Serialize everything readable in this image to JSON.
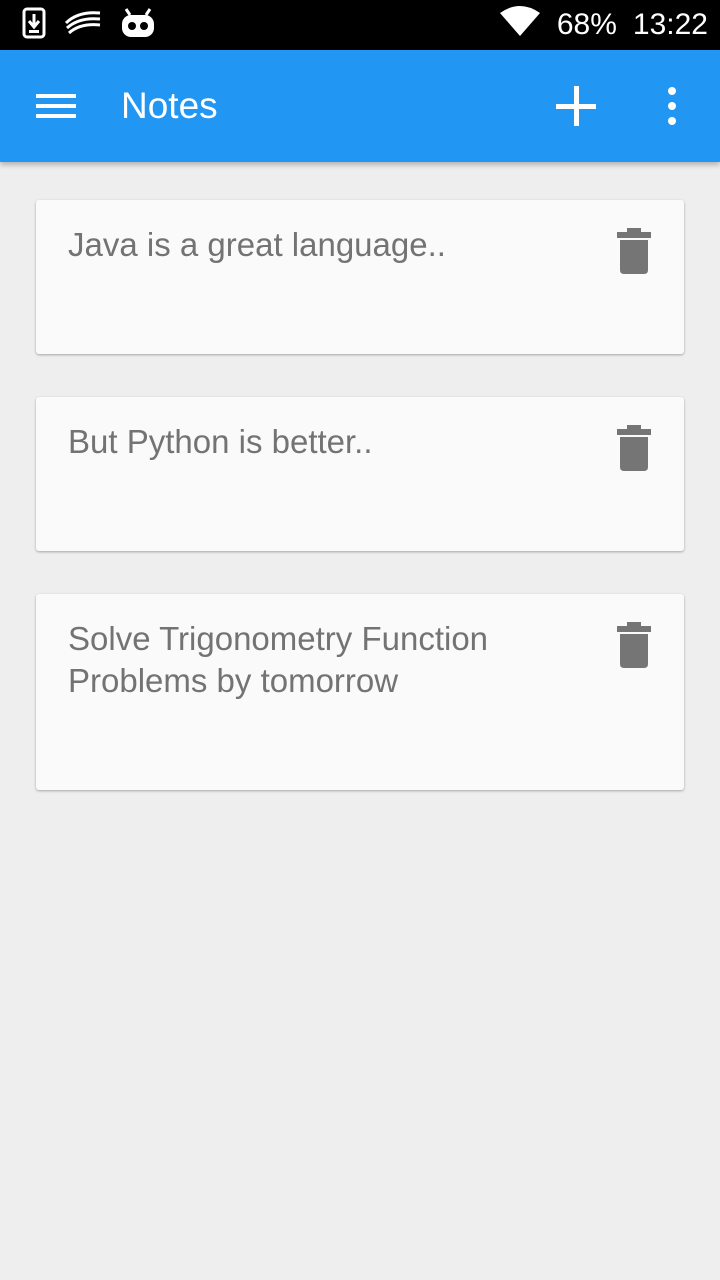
{
  "status_bar": {
    "icons": [
      "download-icon",
      "swiftkey-icon",
      "cyanogenmod-icon",
      "wifi-icon"
    ],
    "battery": "68%",
    "time": "13:22"
  },
  "app_bar": {
    "title": "Notes",
    "color": "#2196f3",
    "icons": [
      "menu-icon",
      "plus-icon",
      "more-vert-icon"
    ]
  },
  "notes": [
    {
      "text": "Java is a great language..",
      "delete_icon": "trash-icon"
    },
    {
      "text": "But Python is better..",
      "delete_icon": "trash-icon"
    },
    {
      "text": "Solve Trigonometry Function Problems by tomorrow",
      "delete_icon": "trash-icon"
    }
  ]
}
